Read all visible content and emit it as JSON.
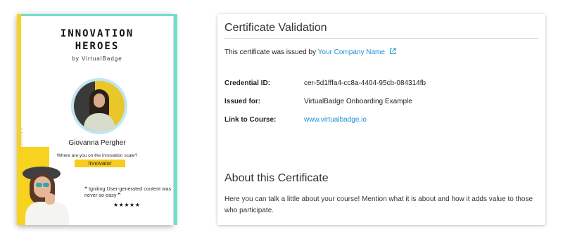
{
  "certificate": {
    "title_line1": "INNOVATION",
    "title_line2": "HEROES",
    "by_line": "by VirtualBadge",
    "vertical_id": "cer-5d1fffa4-cc8a-4404-95cb-084314fb",
    "person_name": "Giovanna Pergher",
    "question": "Where are you on the innovation scale?",
    "level": "Innovator",
    "quote": "❝ Igniting User-generated content was never so easy ❞",
    "stars": "★★★★★",
    "colors": {
      "yellow": "#f7d21f",
      "teal": "#6fe0c8"
    }
  },
  "validation": {
    "heading": "Certificate Validation",
    "issued_prefix": "This certificate was issued by",
    "issuer_name": "Your Company Name",
    "issuer_icon": "external-link-icon",
    "rows": [
      {
        "label": "Credential ID:",
        "value": "cer-5d1fffa4-cc8a-4404-95cb-084314fb"
      },
      {
        "label": "Issued for:",
        "value": "VirtualBadge Onboarding Example"
      },
      {
        "label": "Link to Course:",
        "value": "www.virtualbadge.io"
      }
    ],
    "link_color": "#1f8fd6"
  },
  "about": {
    "heading": "About this Certificate",
    "text": "Here you can talk a little about your course! Mention what it is about and how it adds value to those who participate."
  }
}
